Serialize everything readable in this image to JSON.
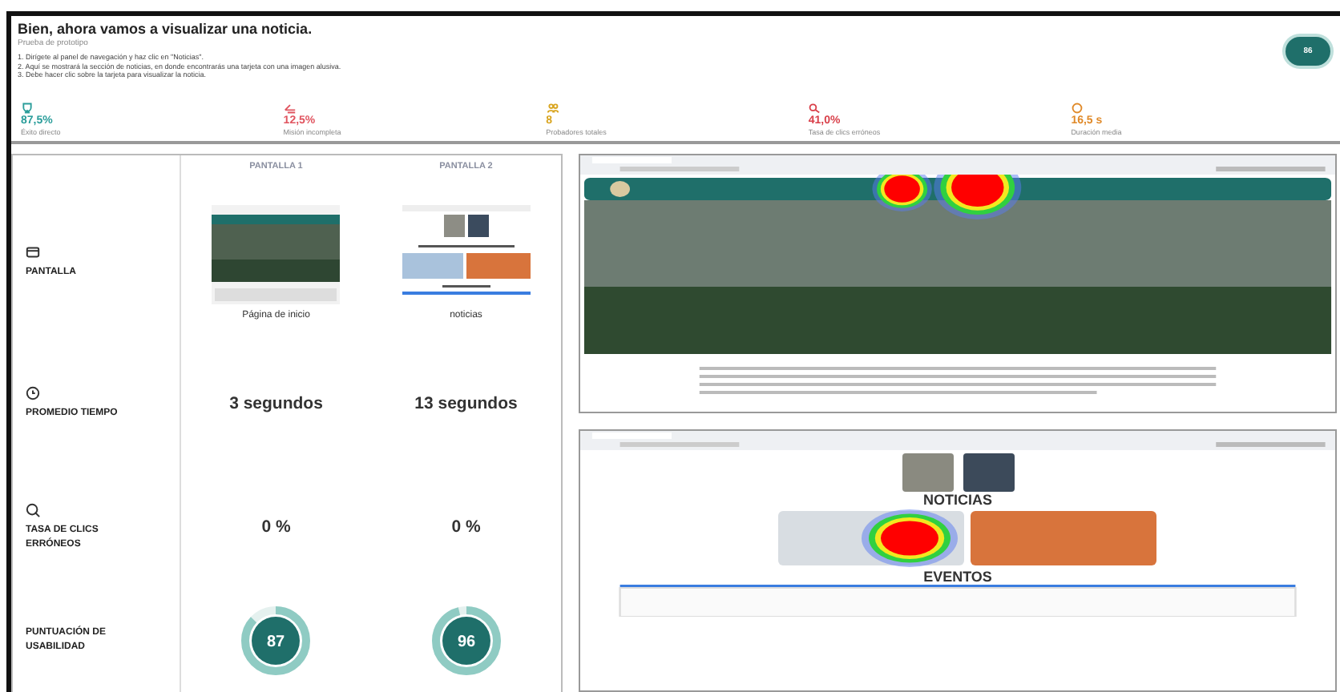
{
  "header": {
    "title": "Bien, ahora vamos a visualizar una noticia.",
    "subtitle": "Prueba de prototipo",
    "steps": [
      "1. Dirígete al panel de navegación y haz clic en \"Noticias\".",
      "2. Aquí se mostrará la sección de noticias, en donde encontrarás una tarjeta con una imagen alusiva.",
      "3. Debe hacer clic sobre la tarjeta para visualizar la noticia."
    ],
    "score_badge": "86"
  },
  "metrics": [
    {
      "kind": "success",
      "value": "87,5%",
      "label": "Éxito directo",
      "color": "#2a9d9a"
    },
    {
      "kind": "incomplete",
      "value": "12,5%",
      "label": "Misión incompleta",
      "color": "#e0545f"
    },
    {
      "kind": "testers",
      "value": "8",
      "label": "Probadores totales",
      "color": "#d9a520"
    },
    {
      "kind": "misclick",
      "value": "41,0%",
      "label": "Tasa de clics erróneos",
      "color": "#d9404a"
    },
    {
      "kind": "duration",
      "value": "16,5 s",
      "label": "Duración media",
      "color": "#e08a2a"
    }
  ],
  "comparison": {
    "columns": [
      "PANTALLA 1",
      "PANTALLA 2"
    ],
    "rows": [
      {
        "kind": "screens",
        "label": "PANTALLA",
        "cells": [
          {
            "caption": "Página de inicio",
            "kind": "home"
          },
          {
            "caption": "noticias",
            "kind": "news"
          }
        ]
      },
      {
        "kind": "text",
        "label": "PROMEDIO TIEMPO",
        "cells": [
          {
            "value": "3 segundos"
          },
          {
            "value": "13 segundos"
          }
        ]
      },
      {
        "kind": "text",
        "label": "TASA DE CLICS ERRÓNEOS",
        "cells": [
          {
            "value": "0 %"
          },
          {
            "value": "0 %"
          }
        ]
      },
      {
        "kind": "score",
        "label": "PUNTUACIÓN DE USABILIDAD",
        "cells": [
          {
            "value": "87",
            "level": 0.87
          },
          {
            "value": "96",
            "level": 0.96
          }
        ]
      }
    ]
  },
  "heatmaps": [
    {
      "kind": "home"
    },
    {
      "kind": "news",
      "headings": [
        "NOTICIAS",
        "EVENTOS"
      ]
    }
  ]
}
